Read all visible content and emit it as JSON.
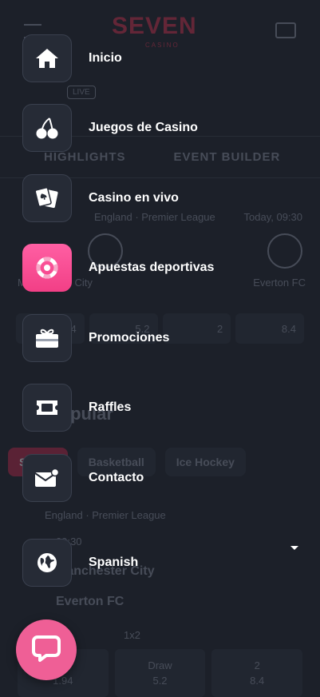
{
  "colors": {
    "background": "#1c2029",
    "menu_tile": "#262b36",
    "active_tile": "#f23f86",
    "chat_button": "#ef5f96",
    "text": "#ffffff"
  },
  "menu": {
    "items": [
      {
        "label": "Inicio",
        "icon": "home-icon",
        "active": false
      },
      {
        "label": "Juegos de Casino",
        "icon": "cherries-icon",
        "active": false
      },
      {
        "label": "Casino en vivo",
        "icon": "playing-cards-icon",
        "active": false
      },
      {
        "label": "Apuestas deportivas",
        "icon": "lifebuoy-icon",
        "active": true
      },
      {
        "label": "Promociones",
        "icon": "gift-icon",
        "active": false
      },
      {
        "label": "Raffles",
        "icon": "ticket-icon",
        "active": false
      },
      {
        "label": "Contacto",
        "icon": "mail-icon",
        "active": false
      }
    ],
    "language": {
      "label": "Spanish",
      "icon": "globe-icon"
    }
  },
  "chat": {
    "icon": "chat-icon"
  },
  "background_app": {
    "logo": "SEVEN",
    "logo_sub": "CASINO",
    "live_badge": "LIVE",
    "strip": [
      "HIGHLIGHTS",
      "EVENT BUILDER"
    ],
    "match_league": "England · Premier League",
    "match_time": "Today, 09:30",
    "team_home_short": "Manchester City",
    "team_away": "Everton FC",
    "odds": [
      "1.94",
      "5.2",
      "2",
      "8.4"
    ],
    "popular_title": "Popular",
    "sports": [
      "Soccer",
      "Basketball",
      "Ice Hockey"
    ],
    "league_row": "England · Premier League",
    "time_row": "09:30",
    "team1": "Manchester City",
    "team2": "Everton FC",
    "market": "1x2",
    "bottom_odds": [
      {
        "label": "1",
        "value": "1.94"
      },
      {
        "label": "Draw",
        "value": "5.2"
      },
      {
        "label": "2",
        "value": "8.4"
      }
    ]
  }
}
